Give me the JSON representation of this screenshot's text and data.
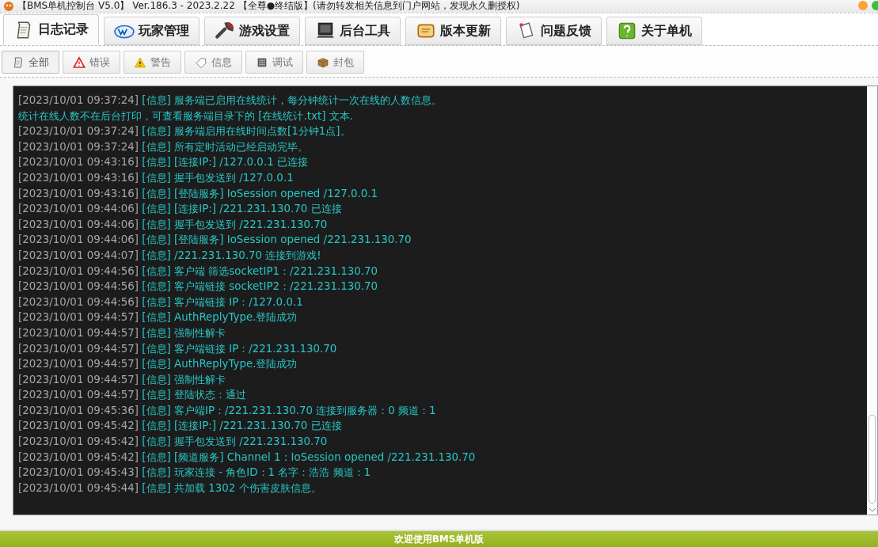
{
  "window": {
    "title": "【BMS单机控制台 V5.0】 Ver.186.3 - 2023.2.22 【全尊●终结版】(请勿转发相关信息到门户网站，发现永久删授权)"
  },
  "main_tabs": [
    {
      "label": "日志记录",
      "kind": "notepad",
      "selected": true
    },
    {
      "label": "玩家管理",
      "kind": "mail",
      "selected": false
    },
    {
      "label": "游戏设置",
      "kind": "wrench",
      "selected": false
    },
    {
      "label": "后台工具",
      "kind": "monitor",
      "selected": false
    },
    {
      "label": "版本更新",
      "kind": "scroll",
      "selected": false
    },
    {
      "label": "问题反馈",
      "kind": "papers",
      "selected": false
    },
    {
      "label": "关于单机",
      "kind": "help",
      "selected": false
    }
  ],
  "filter_tabs": [
    {
      "label": "全部",
      "kind": "note",
      "selected": true
    },
    {
      "label": "错误",
      "kind": "error",
      "selected": false
    },
    {
      "label": "警告",
      "kind": "warning",
      "selected": false
    },
    {
      "label": "信息",
      "kind": "info",
      "selected": false
    },
    {
      "label": "调试",
      "kind": "debug",
      "selected": false
    },
    {
      "label": "封包",
      "kind": "packet",
      "selected": false
    }
  ],
  "log": [
    {
      "kind": "entry",
      "time": "[2023/10/01 09:37:24]",
      "level": "[信息]",
      "message": "服务端已启用在线统计，每分钟统计一次在线的人数信息。"
    },
    {
      "kind": "continuation",
      "message": "统计在线人数不在后台打印，可查看服务端目录下的 [在线统计.txt] 文本."
    },
    {
      "kind": "entry",
      "time": "[2023/10/01 09:37:24]",
      "level": "[信息]",
      "message": "服务端启用在线时间点数[1分钟1点]。"
    },
    {
      "kind": "entry",
      "time": "[2023/10/01 09:37:24]",
      "level": "[信息]",
      "message": "所有定时活动已经启动完毕。"
    },
    {
      "kind": "entry",
      "time": "[2023/10/01 09:43:16]",
      "level": "[信息]",
      "message": "[连接IP:] /127.0.0.1 已连接"
    },
    {
      "kind": "entry",
      "time": "[2023/10/01 09:43:16]",
      "level": "[信息]",
      "message": "握手包发送到 /127.0.0.1"
    },
    {
      "kind": "entry",
      "time": "[2023/10/01 09:43:16]",
      "level": "[信息]",
      "message": "[登陆服务] IoSession opened /127.0.0.1"
    },
    {
      "kind": "entry",
      "time": "[2023/10/01 09:44:06]",
      "level": "[信息]",
      "message": "[连接IP:] /221.231.130.70 已连接"
    },
    {
      "kind": "entry",
      "time": "[2023/10/01 09:44:06]",
      "level": "[信息]",
      "message": "握手包发送到 /221.231.130.70"
    },
    {
      "kind": "entry",
      "time": "[2023/10/01 09:44:06]",
      "level": "[信息]",
      "message": "[登陆服务] IoSession opened /221.231.130.70"
    },
    {
      "kind": "entry",
      "time": "[2023/10/01 09:44:07]",
      "level": "[信息]",
      "message": "/221.231.130.70 连接到游戏!"
    },
    {
      "kind": "entry",
      "time": "[2023/10/01 09:44:56]",
      "level": "[信息]",
      "message": "客户端 筛选socketIP1：/221.231.130.70"
    },
    {
      "kind": "entry",
      "time": "[2023/10/01 09:44:56]",
      "level": "[信息]",
      "message": "客户端链接 socketIP2：/221.231.130.70"
    },
    {
      "kind": "entry",
      "time": "[2023/10/01 09:44:56]",
      "level": "[信息]",
      "message": "客户端链接 IP：/127.0.0.1"
    },
    {
      "kind": "entry",
      "time": "[2023/10/01 09:44:57]",
      "level": "[信息]",
      "message": "AuthReplyType.登陆成功"
    },
    {
      "kind": "entry",
      "time": "[2023/10/01 09:44:57]",
      "level": "[信息]",
      "message": "强制性解卡"
    },
    {
      "kind": "entry",
      "time": "[2023/10/01 09:44:57]",
      "level": "[信息]",
      "message": "客户端链接 IP：/221.231.130.70"
    },
    {
      "kind": "entry",
      "time": "[2023/10/01 09:44:57]",
      "level": "[信息]",
      "message": "AuthReplyType.登陆成功"
    },
    {
      "kind": "entry",
      "time": "[2023/10/01 09:44:57]",
      "level": "[信息]",
      "message": "强制性解卡"
    },
    {
      "kind": "entry",
      "time": "[2023/10/01 09:44:57]",
      "level": "[信息]",
      "message": "登陆状态：通过"
    },
    {
      "kind": "entry",
      "time": "[2023/10/01 09:45:36]",
      "level": "[信息]",
      "message": "客户端IP：/221.231.130.70 连接到服务器：0 频道：1"
    },
    {
      "kind": "entry",
      "time": "[2023/10/01 09:45:42]",
      "level": "[信息]",
      "message": "[连接IP:] /221.231.130.70 已连接"
    },
    {
      "kind": "entry",
      "time": "[2023/10/01 09:45:42]",
      "level": "[信息]",
      "message": "握手包发送到 /221.231.130.70"
    },
    {
      "kind": "entry",
      "time": "[2023/10/01 09:45:42]",
      "level": "[信息]",
      "message": "[频道服务] Channel 1 : IoSession opened /221.231.130.70"
    },
    {
      "kind": "entry",
      "time": "[2023/10/01 09:45:43]",
      "level": "[信息]",
      "message": "玩家连接 - 角色ID：1 名字：浩浩 频道：1"
    },
    {
      "kind": "entry",
      "time": "[2023/10/01 09:45:44]",
      "level": "[信息]",
      "message": "共加载 1302 个伤害皮肤信息。"
    }
  ],
  "status_bar": {
    "text": "欢迎使用BMS单机版"
  }
}
